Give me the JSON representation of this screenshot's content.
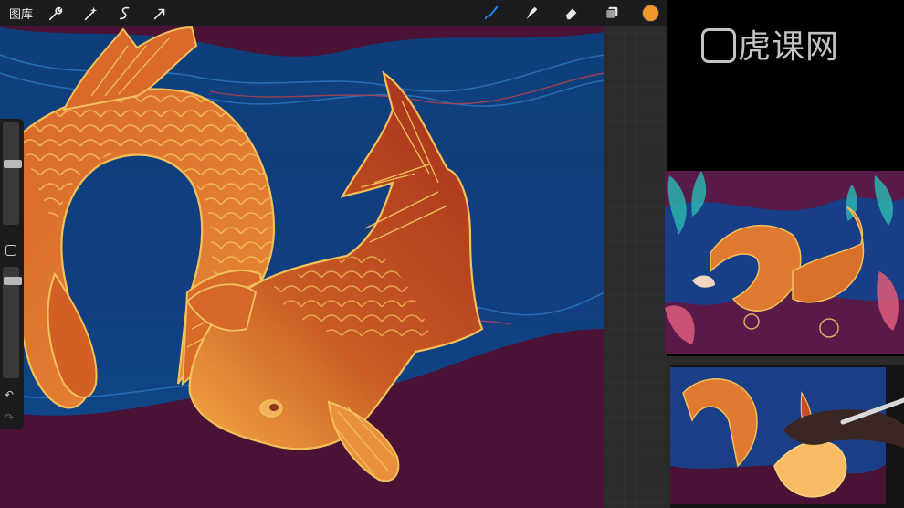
{
  "toolbar": {
    "gallery_label": "图库",
    "left_tools": [
      "wrench-icon",
      "magic-wand-icon",
      "selection-icon",
      "transform-arrow-icon"
    ],
    "right_tools": [
      "brush-icon",
      "smudge-icon",
      "eraser-icon",
      "layers-icon"
    ],
    "current_color": "#f0972f"
  },
  "watermark": {
    "text": "虎课网"
  },
  "colors": {
    "accent_blue": "#1a8cff",
    "canvas_sea": "#0f3f7a",
    "canvas_deep": "#4a1234",
    "koi_orange": "#e2782a",
    "outline_gold": "#f2c15a"
  },
  "sidebar": {
    "brush_size_level": 0.6,
    "opacity_level": 0.1
  }
}
